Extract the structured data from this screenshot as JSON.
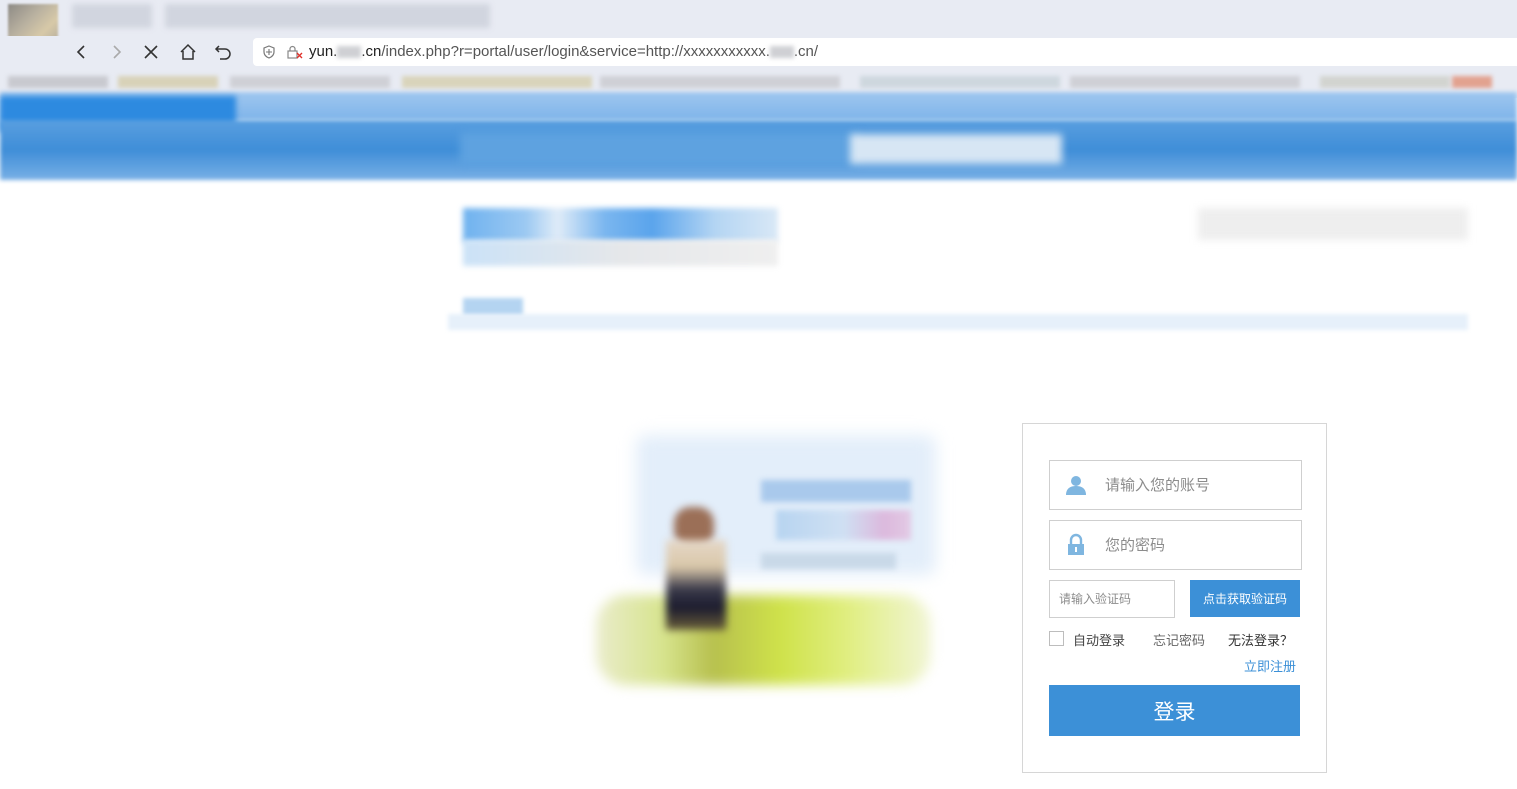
{
  "browser": {
    "url_host": "yun.",
    "url_host_suffix": ".cn",
    "url_path": "/index.php?r=portal/user/login&service=http://xxxxxxxxxxx.",
    "url_tail": ".cn/",
    "icons": {
      "back": "back-arrow-icon",
      "forward": "forward-arrow-icon",
      "stop": "close-icon",
      "home": "home-icon",
      "undo": "undo-icon",
      "shield": "shield-icon",
      "lock": "insecure-lock-icon"
    }
  },
  "login": {
    "account_placeholder": "请输入您的账号",
    "password_placeholder": "您的密码",
    "captcha_placeholder": "请输入验证码",
    "get_captcha_label": "点击获取验证码",
    "auto_login_label": "自动登录",
    "forgot_password_label": "忘记密码",
    "cannot_login_label": "无法登录？",
    "register_label": "立即注册",
    "login_button_label": "登录",
    "auto_login_checked": false
  },
  "colors": {
    "accent": "#3c90d7",
    "header_blue": "#3f8ed8",
    "icon_blue": "#7fb6e0"
  }
}
